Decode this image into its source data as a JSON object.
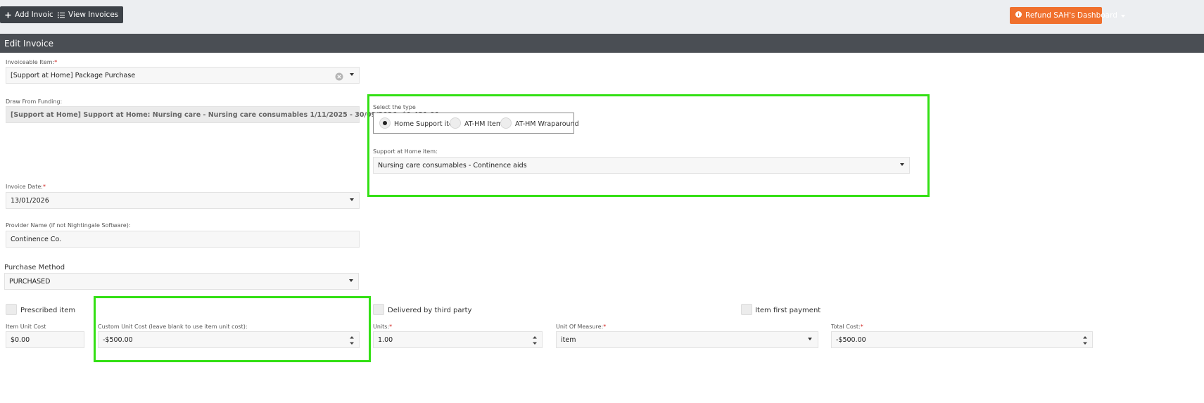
{
  "toolbar": {
    "add_invoice": "Add Invoice",
    "view_invoices": "View Invoices",
    "dashboard": "Refund SAH's Dashboard"
  },
  "panel": {
    "title": "Edit Invoice"
  },
  "form": {
    "invoiceable_item": {
      "label": "Invoiceable Item:",
      "required": "*",
      "value": "[Support at Home] Package Purchase"
    },
    "draw_from_funding": {
      "label": "Draw From Funding:",
      "value": "[Support at Home] Support at Home: Nursing care - Nursing care consumables 1/11/2025 - 30/09/2026, $9,431.91"
    },
    "select_type": {
      "label": "Select the type",
      "options": [
        "Home Support item",
        "AT-HM Item",
        "AT-HM Wraparound"
      ],
      "selected": "Home Support item"
    },
    "sah_item": {
      "label": "Support at Home item:",
      "value": "Nursing care consumables - Continence aids"
    },
    "invoice_date": {
      "label": "Invoice Date:",
      "required": "*",
      "value": "13/01/2026"
    },
    "provider_name": {
      "label": "Provider Name (if not Nightingale Software):",
      "value": "Continence Co."
    },
    "purchase_method": {
      "label": "Purchase Method",
      "value": "PURCHASED"
    },
    "prescribed_item": {
      "label": "Prescribed item",
      "checked": false
    },
    "delivered_by_third_party": {
      "label": "Delivered by third party",
      "checked": false
    },
    "item_first_payment": {
      "label": "Item first payment",
      "checked": false
    },
    "item_unit_cost": {
      "label": "Item Unit Cost",
      "value": "$0.00"
    },
    "custom_unit_cost": {
      "label": "Custom Unit Cost (leave blank to use item unit cost):",
      "value": "-$500.00"
    },
    "units": {
      "label": "Units:",
      "required": "*",
      "value": "1.00"
    },
    "unit_of_measure": {
      "label": "Unit Of Measure:",
      "required": "*",
      "value": "item"
    },
    "total_cost": {
      "label": "Total Cost:",
      "required": "*",
      "value": "-$500.00"
    }
  },
  "colors": {
    "highlight": "#33e014",
    "toolbar_button": "#3d4248",
    "dashboard_button": "#f0702d",
    "panel_header": "#4a4e54",
    "required": "#d0211c"
  },
  "icons": {
    "add": "plus-icon",
    "list": "list-icon",
    "dashboard": "info-circle-icon",
    "clear": "clear-circle-icon"
  }
}
